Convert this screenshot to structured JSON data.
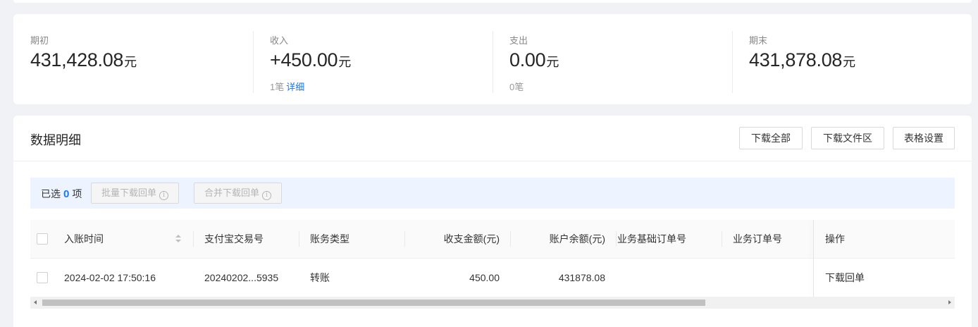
{
  "summary": {
    "items": [
      {
        "label": "期初",
        "value": "431,428.08",
        "unit": "元",
        "sub_count": "",
        "sub_link": ""
      },
      {
        "label": "收入",
        "value": "+450.00",
        "unit": "元",
        "sub_count": "1笔",
        "sub_link": "详细"
      },
      {
        "label": "支出",
        "value": "0.00",
        "unit": "元",
        "sub_count": "0笔",
        "sub_link": ""
      },
      {
        "label": "期末",
        "value": "431,878.08",
        "unit": "元",
        "sub_count": "",
        "sub_link": ""
      }
    ]
  },
  "detail": {
    "title": "数据明细",
    "buttons": {
      "download_all": "下载全部",
      "download_area": "下载文件区",
      "table_settings": "表格设置"
    },
    "selection": {
      "prefix": "已选",
      "count": "0",
      "suffix": "项",
      "batch_download": "批量下载回单",
      "merge_download": "合并下载回单"
    },
    "table": {
      "columns": [
        "入账时间",
        "支付宝交易号",
        "账务类型",
        "收支金额(元)",
        "账户余额(元)",
        "业务基础订单号",
        "业务订单号",
        "操作"
      ],
      "rows": [
        {
          "time": "2024-02-02 17:50:16",
          "trade_no": "20240202...5935",
          "type": "转账",
          "amount": "450.00",
          "balance": "431878.08",
          "base_order": "",
          "order": "",
          "action": "下载回单"
        }
      ]
    }
  },
  "colors": {
    "accent": "#1677ff",
    "page_bg": "#f0f2f5",
    "select_bar_bg": "#eef4ff"
  }
}
